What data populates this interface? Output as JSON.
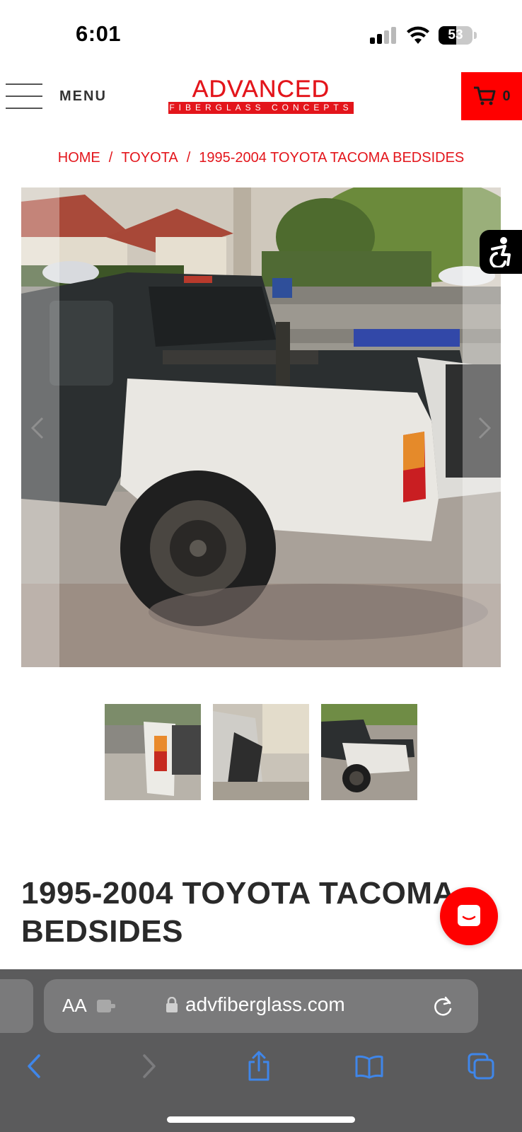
{
  "status_bar": {
    "time": "6:01",
    "battery": "53",
    "icons": [
      "signal-icon",
      "wifi-icon",
      "battery-icon"
    ]
  },
  "header": {
    "menu_label": "MENU",
    "logo_word": "ADVANCED",
    "logo_sub": "FIBERGLASS CONCEPTS",
    "cart_count": "0",
    "brand_color": "#e3151b",
    "cart_bg": "#ff0000"
  },
  "breadcrumb": {
    "items": [
      "HOME",
      "TOYOTA",
      "1995-2004 TOYOTA TACOMA BEDSIDES"
    ],
    "separator": "/"
  },
  "gallery": {
    "main_image": "truck-photo",
    "thumbnails": [
      "bedside-rear-photo",
      "bedside-side-photo",
      "truck-full-photo"
    ],
    "icons": [
      "chevron-left-icon",
      "chevron-right-icon",
      "accessibility-icon"
    ]
  },
  "product": {
    "title": "1995-2004 TOYOTA TACOMA BEDSIDES"
  },
  "chat": {
    "icon": "chat-icon"
  },
  "browser": {
    "text_size_label": "AA",
    "url": "advfiberglass.com",
    "toolbar_icons": [
      "back-icon",
      "forward-icon",
      "share-icon",
      "bookmarks-icon",
      "tabs-icon"
    ],
    "bar_color": "#5b5b5c"
  }
}
